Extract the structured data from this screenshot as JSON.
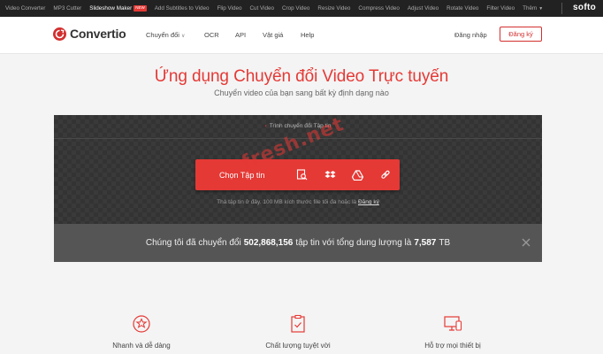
{
  "topbar": {
    "links": [
      "Video Converter",
      "MP3 Cutter",
      "Slideshow Maker",
      "Add Subtitles to Video",
      "Flip Video",
      "Cut Video",
      "Crop Video",
      "Resize Video",
      "Compress Video",
      "Adjust Video",
      "Rotate Video",
      "Filter Video",
      "Thêm"
    ],
    "new_badge": "NEW",
    "logo": "softo"
  },
  "nav": {
    "brand": "Convertio",
    "convert": "Chuyển đổi",
    "ocr": "OCR",
    "api": "API",
    "pricing": "Vật giá",
    "help": "Help",
    "login": "Đăng nhập",
    "signup": "Đăng ký"
  },
  "hero": {
    "title": "Ứng dụng Chuyển đổi Video Trực tuyến",
    "subtitle": "Chuyển video của bạn sang bất kỳ định dạng nào"
  },
  "panel": {
    "crumb": "Trình chuyển đổi Tập tin",
    "choose_label": "Chọn Tập tin",
    "hint_text": "Thả tập tin ở đây. 100 MB kích thước file tối đa hoặc là",
    "hint_link": "Đăng ký",
    "watermark": "fresh.net"
  },
  "stats": {
    "prefix": "Chúng tôi đã chuyển đổi",
    "files": "502,868,156",
    "middle": "tập tin với tổng dung lượng là",
    "size": "7,587",
    "unit": "TB"
  },
  "features": [
    "Nhanh và dễ dàng",
    "Chất lượng tuyệt vời",
    "Hỗ trợ mọi thiết bị"
  ],
  "colors": {
    "accent": "#e53935",
    "topbar": "#222222",
    "panel": "#3a3a3a"
  }
}
